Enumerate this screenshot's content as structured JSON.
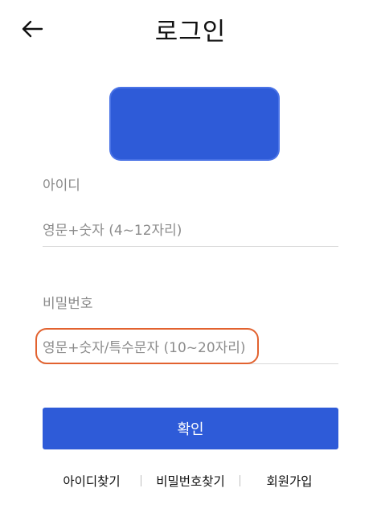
{
  "header": {
    "title": "로그인",
    "back_icon": "arrow-left-icon"
  },
  "logo": {
    "color": "#2e5bd8"
  },
  "form": {
    "id_label": "아이디",
    "id_placeholder": "영문+숫자 (4~12자리)",
    "pw_label": "비밀번호",
    "pw_placeholder": "영문+숫자/특수문자 (10~20자리)"
  },
  "confirm_button": {
    "label": "확인",
    "color": "#2e5bd8"
  },
  "links": {
    "find_id": "아이디찾기",
    "find_pw": "비밀번호찾기",
    "signup": "회원가입"
  },
  "annotation": {
    "ring_color": "#e2622f"
  }
}
